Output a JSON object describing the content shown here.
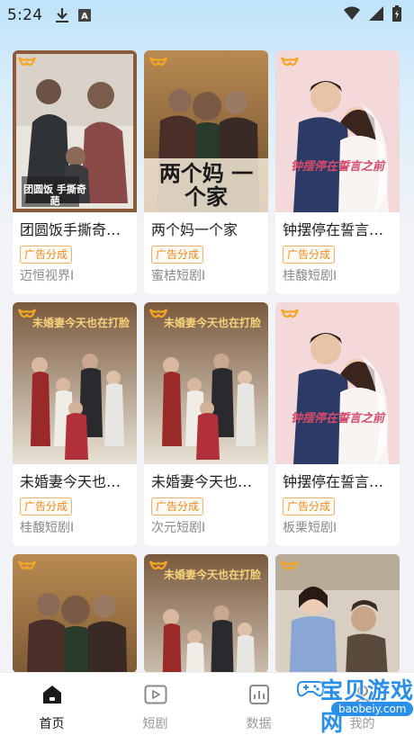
{
  "status_bar": {
    "time": "5:24",
    "icons": [
      "download-icon",
      "a-badge-icon",
      "wifi-icon",
      "signal-icon",
      "battery-icon"
    ]
  },
  "cards": [
    {
      "title": "团圆饭手撕奇葩",
      "title_display": "团圆饭手撕奇…",
      "tag": "广告分成",
      "studio": "迈恒视界I",
      "poster_caption": "团圆饭 手撕奇葩"
    },
    {
      "title": "两个妈一个家",
      "title_display": "两个妈一个家",
      "tag": "广告分成",
      "studio": "蜜桔短剧I",
      "poster_caption": "两个妈 一个家"
    },
    {
      "title": "钟摆停在誓言之前",
      "title_display": "钟摆停在誓言…",
      "tag": "广告分成",
      "studio": "桂馥短剧I",
      "poster_caption": "钟摆停在誓言之前"
    },
    {
      "title": "未婚妻今天也在打脸",
      "title_display": "未婚妻今天也…",
      "tag": "广告分成",
      "studio": "桂馥短剧I",
      "poster_caption": "未婚妻今天也在打脸"
    },
    {
      "title": "未婚妻今天也在打脸",
      "title_display": "未婚妻今天也…",
      "tag": "广告分成",
      "studio": "次元短剧I",
      "poster_caption": "未婚妻今天也在打脸"
    },
    {
      "title": "钟摆停在誓言之前",
      "title_display": "钟摆停在誓言…",
      "tag": "广告分成",
      "studio": "板栗短剧I",
      "poster_caption": "钟摆停在誓言之前"
    },
    {
      "poster_caption": ""
    },
    {
      "poster_caption": "未婚妻今天也在打脸"
    },
    {
      "poster_caption": ""
    }
  ],
  "tabbar": {
    "tabs": [
      {
        "label": "首页",
        "icon": "home-icon",
        "active": true
      },
      {
        "label": "短剧",
        "icon": "play-icon",
        "active": false
      },
      {
        "label": "数据",
        "icon": "chart-icon",
        "active": false
      },
      {
        "label": "我的",
        "icon": "person-icon",
        "active": false
      }
    ]
  },
  "watermark": {
    "cn": "宝贝游戏网",
    "en": "baobeiy.com"
  },
  "colors": {
    "tag": "#e88a1f",
    "brand_logo": "#f5a623",
    "tab_active": "#1a1a1a",
    "watermark": "#2a8fe8"
  }
}
